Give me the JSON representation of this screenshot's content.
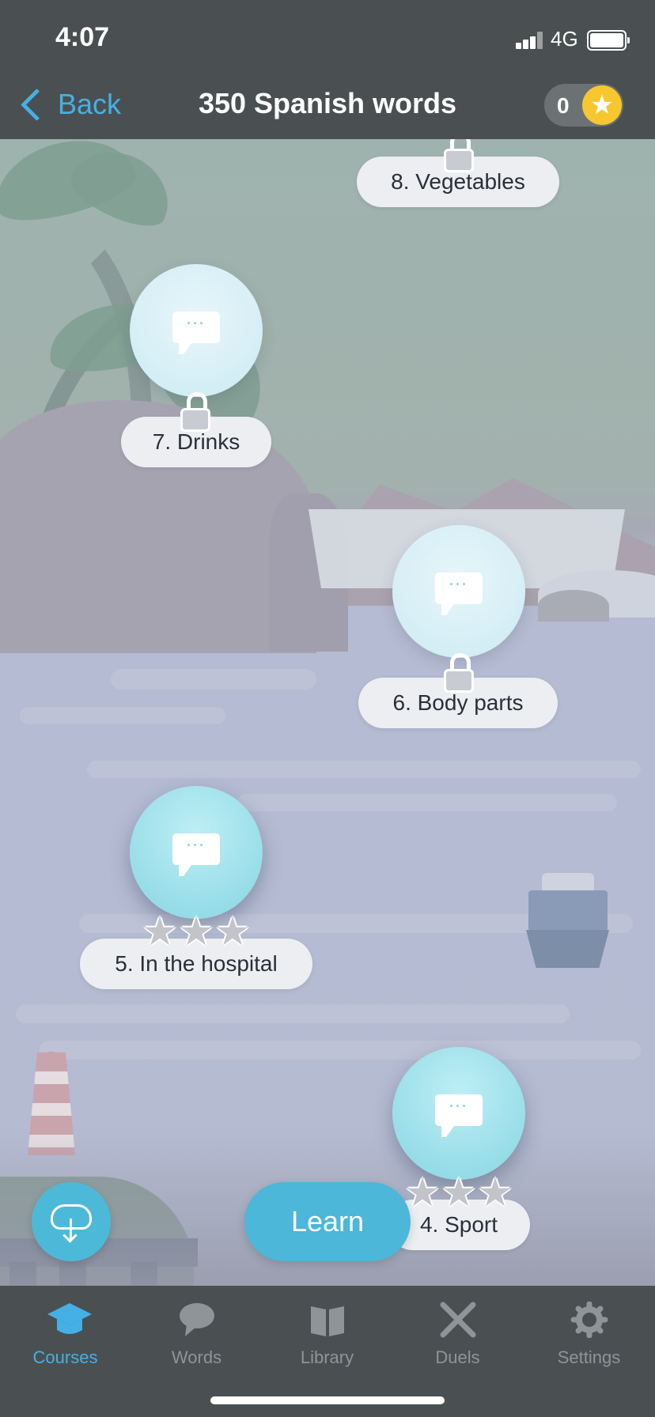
{
  "status_bar": {
    "time": "4:07",
    "network": "4G"
  },
  "nav": {
    "back_label": "Back",
    "title": "350 Spanish words",
    "score": "0",
    "score_icon": "star-icon"
  },
  "lessons": [
    {
      "label": "8. Vegetables",
      "locked": true
    },
    {
      "label": "7. Drinks",
      "locked": true
    },
    {
      "label": "6. Body parts",
      "locked": true
    },
    {
      "label": "5. In the hospital",
      "locked": false,
      "stars": 3
    },
    {
      "label": "4. Sport",
      "locked": false,
      "stars": 3
    }
  ],
  "actions": {
    "learn_label": "Learn",
    "download_icon": "cloud-download-icon"
  },
  "tabs": [
    {
      "label": "Courses",
      "icon": "graduation-cap-icon",
      "active": true
    },
    {
      "label": "Words",
      "icon": "speech-bubble-icon",
      "active": false
    },
    {
      "label": "Library",
      "icon": "book-icon",
      "active": false
    },
    {
      "label": "Duels",
      "icon": "crossed-swords-icon",
      "active": false
    },
    {
      "label": "Settings",
      "icon": "gear-icon",
      "active": false
    }
  ],
  "colors": {
    "accent": "#45b0e6",
    "bar": "#4a5051",
    "button": "#4cb7d8",
    "star": "#f7c72f"
  }
}
